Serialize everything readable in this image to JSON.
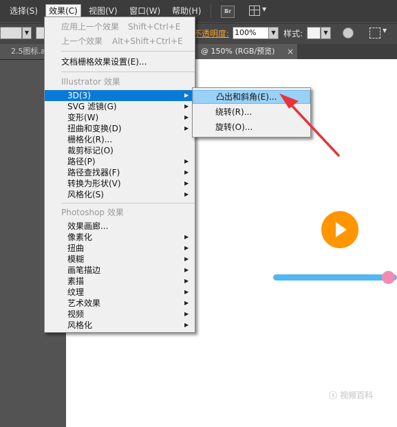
{
  "menubar": {
    "items": [
      {
        "label": "选择(S)"
      },
      {
        "label": "效果(C)",
        "active": true
      },
      {
        "label": "视图(V)"
      },
      {
        "label": "窗口(W)"
      },
      {
        "label": "帮助(H)"
      }
    ],
    "br_label": "Br"
  },
  "control_bar": {
    "opacity_label": "不透明度:",
    "opacity_value": "100%",
    "style_label": "样式:"
  },
  "tabs": {
    "left_tab": "2.5图标.a",
    "active_tab": "@ 150% (RGB/预览)",
    "close_glyph": "×"
  },
  "effect_menu": {
    "recent": [
      {
        "label": "应用上一个效果",
        "shortcut": "Shift+Ctrl+E"
      },
      {
        "label": "上一个效果",
        "shortcut": "Alt+Shift+Ctrl+E"
      }
    ],
    "raster_settings": "文档栅格效果设置(E)...",
    "illustrator_header": "Illustrator 效果",
    "illustrator_items": [
      {
        "label": "3D(3)",
        "submenu": true,
        "highlighted": true
      },
      {
        "label": "SVG 滤镜(G)",
        "submenu": true
      },
      {
        "label": "变形(W)",
        "submenu": true
      },
      {
        "label": "扭曲和变换(D)",
        "submenu": true
      },
      {
        "label": "栅格化(R)...",
        "submenu": false
      },
      {
        "label": "裁剪标记(O)",
        "submenu": false
      },
      {
        "label": "路径(P)",
        "submenu": true
      },
      {
        "label": "路径查找器(F)",
        "submenu": true
      },
      {
        "label": "转换为形状(V)",
        "submenu": true
      },
      {
        "label": "风格化(S)",
        "submenu": true
      }
    ],
    "photoshop_header": "Photoshop 效果",
    "photoshop_items": [
      {
        "label": "效果画廊...",
        "submenu": false
      },
      {
        "label": "像素化",
        "submenu": true
      },
      {
        "label": "扭曲",
        "submenu": true
      },
      {
        "label": "模糊",
        "submenu": true
      },
      {
        "label": "画笔描边",
        "submenu": true
      },
      {
        "label": "素描",
        "submenu": true
      },
      {
        "label": "纹理",
        "submenu": true
      },
      {
        "label": "艺术效果",
        "submenu": true
      },
      {
        "label": "视频",
        "submenu": true
      },
      {
        "label": "风格化",
        "submenu": true
      }
    ],
    "arrow_glyph": "▶"
  },
  "sub_menu": {
    "items": [
      {
        "label": "凸出和斜角(E)...",
        "highlighted": true
      },
      {
        "label": "绕转(R)..."
      },
      {
        "label": "旋转(O)..."
      }
    ]
  },
  "watermark": "ⓢ 视频百科",
  "colors": {
    "menu_highlight": "#0b7ad6",
    "submenu_highlight": "#99d1f7",
    "play_button": "#ff9500",
    "slider_track": "#53b7f2",
    "slider_knob": "#f28bb0",
    "annotation_arrow": "#e8333a"
  }
}
